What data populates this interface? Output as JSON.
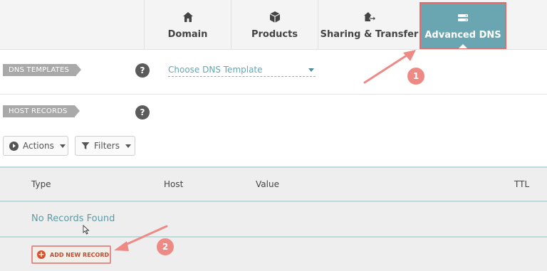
{
  "tabs": {
    "domain": {
      "label": "Domain",
      "icon": "home-icon"
    },
    "products": {
      "label": "Products",
      "icon": "box-icon"
    },
    "sharing": {
      "label": "Sharing & Transfer",
      "icon": "share-house-icon"
    },
    "advanced_dns": {
      "label": "Advanced DNS",
      "icon": "server-icon",
      "active": true
    }
  },
  "dns_templates": {
    "tag": "DNS TEMPLATES",
    "help": "?",
    "select_value": "Choose DNS Template"
  },
  "host_records": {
    "tag": "HOST RECORDS",
    "help": "?"
  },
  "toolbar": {
    "actions_label": "Actions",
    "filters_label": "Filters"
  },
  "table": {
    "columns": [
      "Type",
      "Host",
      "Value",
      "TTL"
    ],
    "empty_message": "No Records Found",
    "add_label": "ADD NEW RECORD"
  },
  "annotations": {
    "badge_1": "1",
    "badge_2": "2"
  },
  "colors": {
    "active_tab": "#6aa6b1",
    "highlight": "#e66a6a",
    "link": "#5fa7b3",
    "add_accent": "#d9512c"
  }
}
